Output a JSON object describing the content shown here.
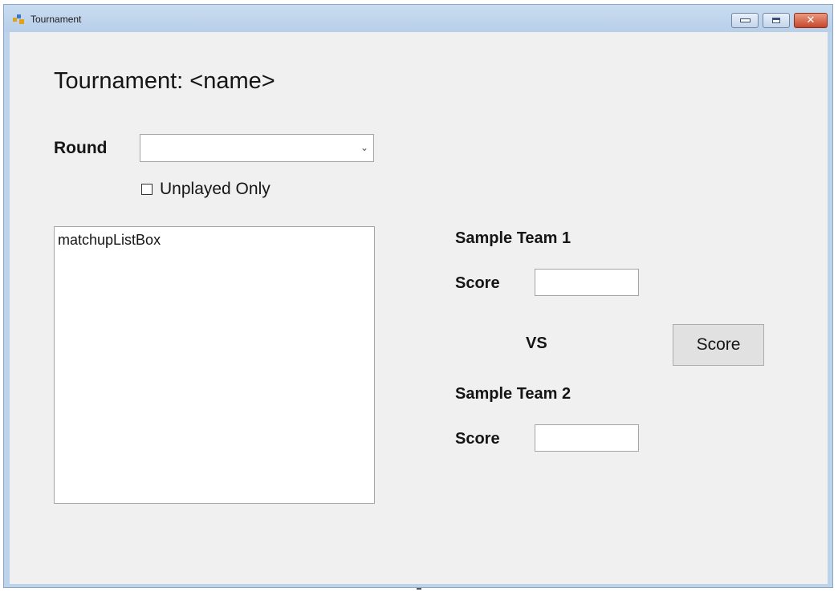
{
  "window": {
    "title": "Tournament",
    "close_glyph": "✕"
  },
  "form": {
    "heading": "Tournament: <name>",
    "round_label": "Round",
    "round_value": "",
    "round_arrow": "⌄",
    "unplayed_only_label": "Unplayed Only",
    "unplayed_only_checked": false,
    "matchup_list_items": [
      "matchupListBox"
    ],
    "team1_name": "Sample Team 1",
    "team1_score_label": "Score",
    "team1_score_value": "",
    "vs_label": "VS",
    "team2_name": "Sample Team 2",
    "team2_score_label": "Score",
    "team2_score_value": "",
    "score_button_label": "Score"
  },
  "colors": {
    "client_background": "#f0f0f0",
    "titlebar": "#c9dcf1",
    "close_button": "#c7472a"
  },
  "icons": {
    "app": "app-icon",
    "minimize": "minimize-icon",
    "maximize": "maximize-icon",
    "close": "close-icon",
    "dropdown": "chevron-down-icon"
  }
}
